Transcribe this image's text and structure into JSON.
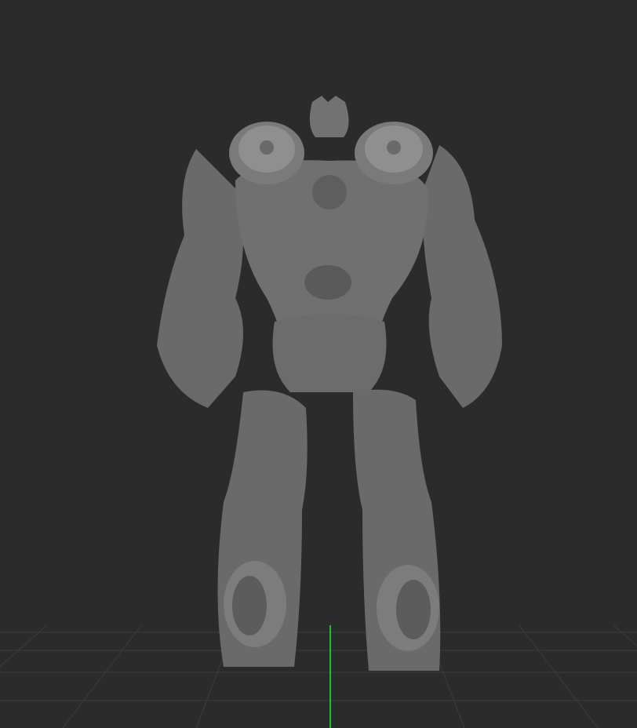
{
  "viewport": {
    "background_color": "#2b2b2b",
    "grid_color": "#3c3c3c",
    "axis_color": "#1fbf2a",
    "model_color": "#6e6e6e",
    "model_shadow_color": "#4a4a4a",
    "model_highlight_color": "#8f8f8f"
  }
}
